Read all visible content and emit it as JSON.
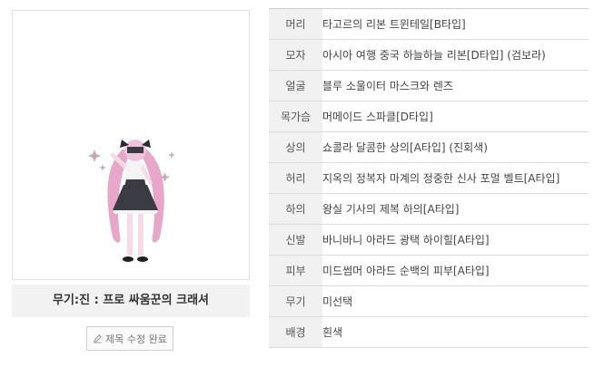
{
  "preview": {
    "caption": "무기:진 : 프로 싸움꾼의 크래셔",
    "edit_button_label": "제목 수정 완료"
  },
  "equipment": [
    {
      "slot": "머리",
      "item": "타고르의 리본 트윈테일[B타입]"
    },
    {
      "slot": "모자",
      "item": "아시아 여행 중국 하늘하늘 리본[D타입] (검보라)"
    },
    {
      "slot": "얼굴",
      "item": "블루 소울이터 마스크와 렌즈"
    },
    {
      "slot": "목가슴",
      "item": "머메이드 스파클[D타입]"
    },
    {
      "slot": "상의",
      "item": "쇼콜라 달콤한 상의[A타입] (진회색)"
    },
    {
      "slot": "허리",
      "item": "지옥의 정복자 마계의 정중한 신사 포멀 벨트[A타입]"
    },
    {
      "slot": "하의",
      "item": "왕실 기사의 제복 하의[A타입]"
    },
    {
      "slot": "신발",
      "item": "바니바니 아라드 광택 하이힐[A타입]"
    },
    {
      "slot": "피부",
      "item": "미드썸머 아라드 순백의 피부[A타입]"
    },
    {
      "slot": "무기",
      "item": "미선택"
    },
    {
      "slot": "배경",
      "item": "흰색"
    }
  ]
}
